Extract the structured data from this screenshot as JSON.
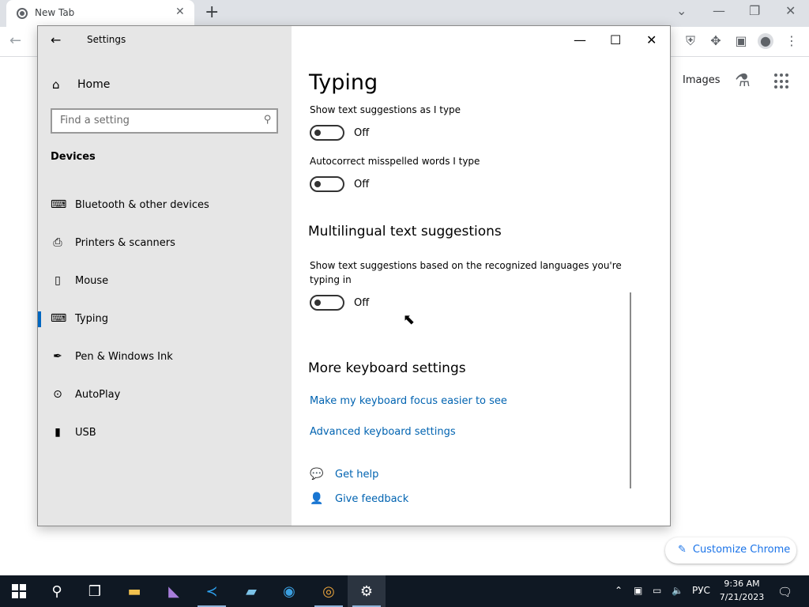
{
  "chrome": {
    "tab_title": "New Tab",
    "tab_close": "✕",
    "new_tab": "+",
    "images_link": "Images",
    "customize_label": "Customize Chrome",
    "icons": [
      "shield-icon",
      "extensions-icon",
      "side-panel-icon",
      "profile-icon",
      "menu-icon"
    ]
  },
  "settings": {
    "window_title": "Settings",
    "back": "←",
    "minimize": "—",
    "maximize": "☐",
    "close": "✕",
    "nav": {
      "home_label": "Home",
      "search_placeholder": "Find a setting",
      "section_title": "Devices",
      "items": [
        {
          "label": "Bluetooth & other devices",
          "icon": "bluetooth-devices-icon"
        },
        {
          "label": "Printers & scanners",
          "icon": "printer-icon"
        },
        {
          "label": "Mouse",
          "icon": "mouse-icon"
        },
        {
          "label": "Typing",
          "icon": "keyboard-icon",
          "selected": true
        },
        {
          "label": "Pen & Windows Ink",
          "icon": "pen-icon"
        },
        {
          "label": "AutoPlay",
          "icon": "autoplay-icon"
        },
        {
          "label": "USB",
          "icon": "usb-icon"
        }
      ]
    },
    "content": {
      "title": "Typing",
      "text_suggestions": {
        "label": "Show text suggestions as I type",
        "state": "Off"
      },
      "autocorrect": {
        "label": "Autocorrect misspelled words I type",
        "state": "Off"
      },
      "multilingual_heading": "Multilingual text suggestions",
      "multilingual": {
        "label": "Show text suggestions based on the recognized languages you're typing in",
        "state": "Off"
      },
      "more_heading": "More keyboard settings",
      "link_focus": "Make my keyboard focus easier to see",
      "link_advanced": "Advanced keyboard settings",
      "get_help": "Get help",
      "give_feedback": "Give feedback"
    }
  },
  "taskbar": {
    "language": "РУС",
    "time": "9:36 AM",
    "date": "7/21/2023"
  }
}
